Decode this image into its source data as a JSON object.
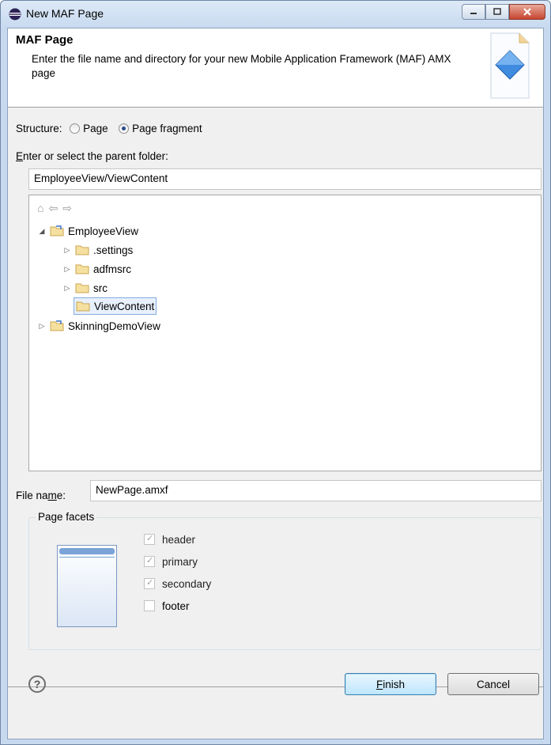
{
  "window": {
    "title": "New MAF Page"
  },
  "header": {
    "title": "MAF Page",
    "description": "Enter the file name and directory for your new Mobile Application Framework (MAF) AMX page"
  },
  "structure": {
    "label": "Structure:",
    "options": [
      "Page",
      "Page fragment"
    ],
    "selected": "Page fragment"
  },
  "parent_folder": {
    "label_prefix": "E",
    "label_rest": "nter or select the parent folder:",
    "value": "EmployeeView/ViewContent"
  },
  "tree": {
    "items": [
      {
        "label": "EmployeeView",
        "expanded": true
      },
      {
        "label": ".settings"
      },
      {
        "label": "adfmsrc"
      },
      {
        "label": "src"
      },
      {
        "label": "ViewContent",
        "selected": true
      },
      {
        "label": "SkinningDemoView"
      }
    ]
  },
  "file_name": {
    "label_a": "File na",
    "label_u": "m",
    "label_b": "e:",
    "value": "NewPage.amxf"
  },
  "facets": {
    "title": "Page facets",
    "items": [
      {
        "label": "header",
        "checked": true,
        "disabled": true
      },
      {
        "label": "primary",
        "checked": true,
        "disabled": true
      },
      {
        "label": "secondary",
        "checked": true,
        "disabled": true
      },
      {
        "label": "footer",
        "checked": false,
        "disabled": false
      }
    ]
  },
  "buttons": {
    "help": "?",
    "finish_u": "F",
    "finish_rest": "inish",
    "cancel": "Cancel"
  }
}
